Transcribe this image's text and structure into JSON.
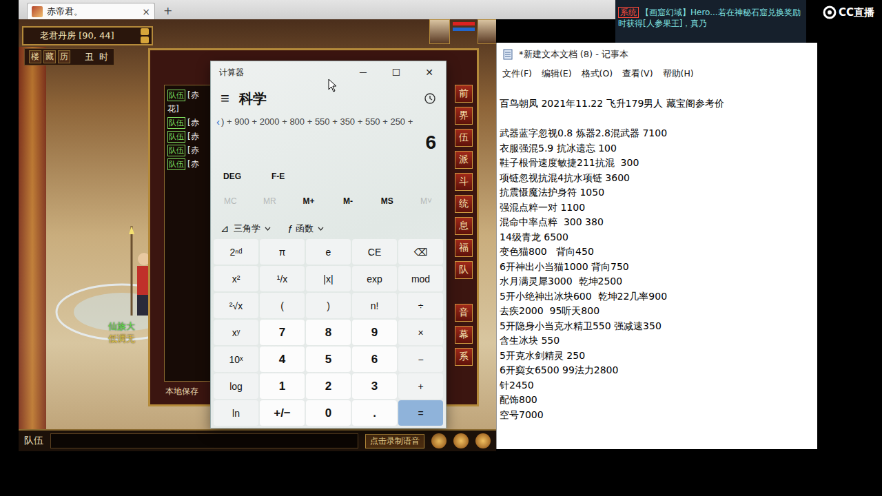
{
  "browser_tab": {
    "title": "赤帝君。",
    "close": "×",
    "new_tab": "+"
  },
  "game": {
    "location": "老君丹房 [90, 44]",
    "toolbar": [
      "楼",
      "藏",
      "历"
    ],
    "time": "丑 时",
    "chat_lines": [
      {
        "tag": "队伍",
        "text": "[赤"
      },
      {
        "tag": "",
        "text": "花]"
      },
      {
        "tag": "队伍",
        "text": "[赤"
      },
      {
        "tag": "队伍",
        "text": "[赤"
      },
      {
        "tag": "队伍",
        "text": "[赤"
      },
      {
        "tag": "队伍",
        "text": "[赤"
      }
    ],
    "save_hint": "本地保存",
    "side_buttons": [
      "前",
      "界",
      "伍",
      "派",
      "斗",
      "统",
      "息",
      "福",
      "队"
    ],
    "side_buttons_lower": [
      "音",
      "幕",
      "系"
    ],
    "player_name": "仙族大",
    "player_title": "低调无",
    "chat_channel": "队伍",
    "voice_hint": "点击录制语音"
  },
  "system_message": {
    "tag": "系统",
    "text": "【画窟幻域】Hero...若在神秘石窟兑换奖励时获得[人参果王]，真乃"
  },
  "logo": "CC直播",
  "calculator": {
    "title": "计算器",
    "controls": [
      "─",
      "☐",
      "✕"
    ],
    "menu_icon": "≡",
    "mode": "科学",
    "expression_arrow": "‹",
    "expression": ") + 900 + 2000 + 800 + 550 + 350 + 550 + 250 +",
    "result": "6",
    "angle_unit": "DEG",
    "notation": "F-E",
    "memory": [
      {
        "label": "MC",
        "disabled": true
      },
      {
        "label": "MR",
        "disabled": true
      },
      {
        "label": "M+",
        "disabled": false
      },
      {
        "label": "M-",
        "disabled": false
      },
      {
        "label": "MS",
        "disabled": false
      },
      {
        "label": "M˅",
        "disabled": true
      }
    ],
    "dropdowns": [
      {
        "icon": "⊿",
        "label": "三角学"
      },
      {
        "icon": "f",
        "label": "函数"
      }
    ],
    "keys": [
      {
        "label": "2ⁿᵈ",
        "kind": "function"
      },
      {
        "label": "π",
        "kind": "function"
      },
      {
        "label": "e",
        "kind": "function"
      },
      {
        "label": "CE",
        "kind": "function"
      },
      {
        "label": "⌫",
        "kind": "function"
      },
      {
        "label": "x²",
        "kind": "function"
      },
      {
        "label": "¹/x",
        "kind": "function"
      },
      {
        "label": "|x|",
        "kind": "function"
      },
      {
        "label": "exp",
        "kind": "function"
      },
      {
        "label": "mod",
        "kind": "function"
      },
      {
        "label": "²√x",
        "kind": "function"
      },
      {
        "label": "(",
        "kind": "function"
      },
      {
        "label": ")",
        "kind": "function"
      },
      {
        "label": "n!",
        "kind": "function"
      },
      {
        "label": "÷",
        "kind": "function"
      },
      {
        "label": "xʸ",
        "kind": "function"
      },
      {
        "label": "7",
        "kind": "digit"
      },
      {
        "label": "8",
        "kind": "digit"
      },
      {
        "label": "9",
        "kind": "digit"
      },
      {
        "label": "×",
        "kind": "function"
      },
      {
        "label": "10ˣ",
        "kind": "function"
      },
      {
        "label": "4",
        "kind": "digit"
      },
      {
        "label": "5",
        "kind": "digit"
      },
      {
        "label": "6",
        "kind": "digit"
      },
      {
        "label": "−",
        "kind": "function"
      },
      {
        "label": "log",
        "kind": "function"
      },
      {
        "label": "1",
        "kind": "digit"
      },
      {
        "label": "2",
        "kind": "digit"
      },
      {
        "label": "3",
        "kind": "digit"
      },
      {
        "label": "+",
        "kind": "function"
      },
      {
        "label": "ln",
        "kind": "function"
      },
      {
        "label": "+/−",
        "kind": "digit"
      },
      {
        "label": "0",
        "kind": "digit"
      },
      {
        "label": ".",
        "kind": "digit"
      },
      {
        "label": "=",
        "kind": "equals"
      }
    ]
  },
  "notepad": {
    "title": "*新建文本文档 (8) - 记事本",
    "menu": [
      "文件(F)",
      "编辑(E)",
      "格式(O)",
      "查看(V)",
      "帮助(H)"
    ],
    "heading": "百鸟朝凤 2021年11.22 飞升179男人 藏宝阁参考价",
    "lines": [
      "武器蓝字忽视0.8 炼器2.8混武器 7100",
      "衣服强混5.9 抗冰遗忘 100",
      "鞋子根骨速度敏捷211抗混  300",
      "项链忽视抗混4抗水项链 3600",
      "抗震慑魔法护身符 1050",
      "强混点粹一对 1100",
      "混命中率点粹  300 380",
      "14级青龙 6500",
      "变色猫800   背向450",
      "6开神出小当猫1000 背向750",
      "水月满灵犀3000  乾坤2500",
      "5开小绝神出冰块600  乾坤22几率900",
      "去疾2000  95听天800",
      "5开隐身小当克水精卫550 强减速350",
      "含生冰块 550",
      "5开克水剑精灵 250",
      "6开窫女6500 99法力2800",
      "针2450",
      "配饰800",
      "空号7000"
    ]
  }
}
